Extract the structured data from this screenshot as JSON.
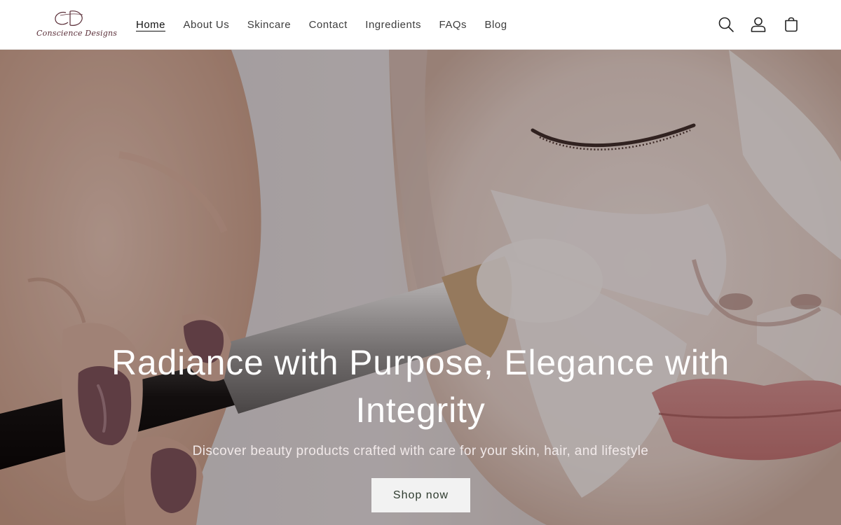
{
  "brand": {
    "monogram": "CD",
    "name": "Conscience Designs"
  },
  "nav": {
    "items": [
      {
        "label": "Home",
        "active": true
      },
      {
        "label": "About Us"
      },
      {
        "label": "Skincare"
      },
      {
        "label": "Contact"
      },
      {
        "label": "Ingredients"
      },
      {
        "label": "FAQs"
      },
      {
        "label": "Blog"
      }
    ]
  },
  "header_icons": [
    "search-icon",
    "account-icon",
    "cart-icon"
  ],
  "hero": {
    "title": "Radiance with Purpose, Elegance with Integrity",
    "subtitle": "Discover beauty products crafted with care for your skin, hair, and lifestyle",
    "cta_label": "Shop now"
  },
  "colors": {
    "brand": "#5a2e38",
    "nav_text": "#3d3d3d",
    "button_bg": "#f2f2f2",
    "button_text": "#2e3b2e"
  }
}
